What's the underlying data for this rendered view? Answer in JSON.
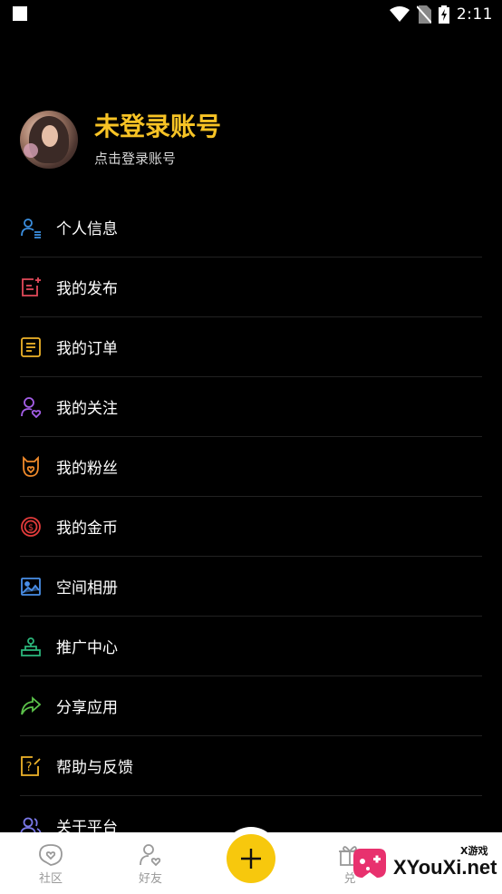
{
  "status_bar": {
    "time": "2:11",
    "icons": [
      "wifi-icon",
      "no-sim-icon",
      "battery-charging-icon"
    ]
  },
  "profile": {
    "title": "未登录账号",
    "subtitle": "点击登录账号"
  },
  "menu": {
    "items": [
      {
        "label": "个人信息",
        "icon": "user-info-icon",
        "color": "#3b8fe0"
      },
      {
        "label": "我的发布",
        "icon": "publish-icon",
        "color": "#e24a5a"
      },
      {
        "label": "我的订单",
        "icon": "order-icon",
        "color": "#f0b429"
      },
      {
        "label": "我的关注",
        "icon": "follow-icon",
        "color": "#a55ee8"
      },
      {
        "label": "我的粉丝",
        "icon": "fans-icon",
        "color": "#f08a2a"
      },
      {
        "label": "我的金币",
        "icon": "coin-icon",
        "color": "#e23b3b"
      },
      {
        "label": "空间相册",
        "icon": "album-icon",
        "color": "#4a8fe8"
      },
      {
        "label": "推广中心",
        "icon": "promotion-icon",
        "color": "#2bb57a"
      },
      {
        "label": "分享应用",
        "icon": "share-icon",
        "color": "#5cc24a"
      },
      {
        "label": "帮助与反馈",
        "icon": "help-icon",
        "color": "#f0b429"
      },
      {
        "label": "关于平台",
        "icon": "about-icon",
        "color": "#7a78e8"
      }
    ]
  },
  "bottom_nav": {
    "items": [
      {
        "label": "社区",
        "icon": "community-icon"
      },
      {
        "label": "好友",
        "icon": "friends-icon"
      },
      {
        "label": "兑",
        "icon": "gift-icon"
      }
    ],
    "fab_icon": "plus-icon",
    "accent": "#f7c80d"
  },
  "watermark": {
    "text": "XYouXi.net",
    "small_text": "X游戏"
  }
}
